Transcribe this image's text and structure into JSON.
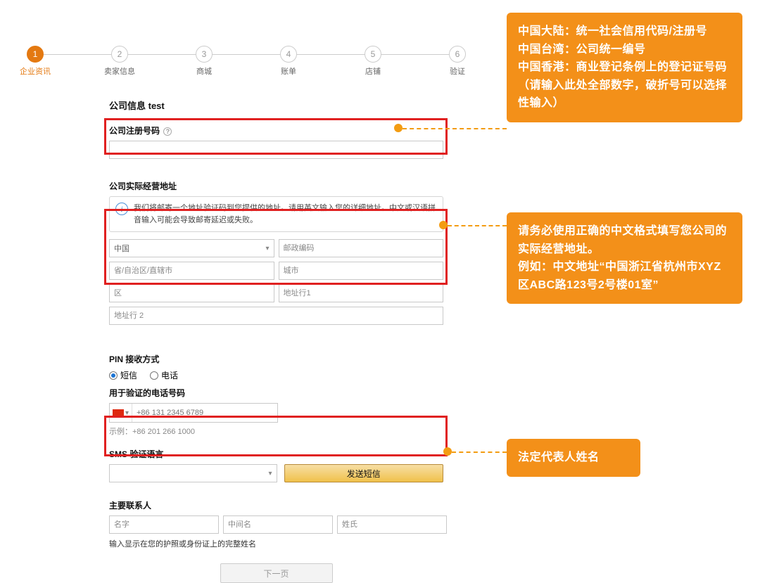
{
  "stepper": {
    "active_index": 0,
    "steps": [
      {
        "num": "1",
        "label": "企业资讯"
      },
      {
        "num": "2",
        "label": "卖家信息"
      },
      {
        "num": "3",
        "label": "商城"
      },
      {
        "num": "4",
        "label": "账单"
      },
      {
        "num": "5",
        "label": "店铺"
      },
      {
        "num": "6",
        "label": "验证"
      }
    ]
  },
  "company": {
    "title": "公司信息 test",
    "regnum_label": "公司注册号码",
    "regnum_value": ""
  },
  "address": {
    "title": "公司实际经营地址",
    "info_text": "我们将邮寄一个地址验证码到您提供的地址。请用英文输入您的详细地址。中文或汉语拼音输入可能会导致邮寄延迟或失败。",
    "fields": {
      "country": "中国",
      "zip_placeholder": "邮政编码",
      "province_placeholder": "省/自治区/直辖市",
      "city_placeholder": "城市",
      "district_placeholder": "区",
      "addr1_placeholder": "地址行1",
      "addr2_placeholder": "地址行 2"
    }
  },
  "pin": {
    "title": "PIN 接收方式",
    "radio_sms": "短信",
    "radio_call": "电话",
    "phone_label": "用于验证的电话号码",
    "phone_placeholder": "+86 131 2345 6789",
    "example": "示例：+86 201 266 1000",
    "sms_lang_label": "SMS 验证语言",
    "send_btn": "发送短信"
  },
  "contact": {
    "title": "主要联系人",
    "first_placeholder": "名字",
    "middle_placeholder": "中间名",
    "last_placeholder": "姓氏",
    "hint": "输入显示在您的护照或身份证上的完整姓名"
  },
  "next_label": "下一页",
  "callouts": {
    "c1": "中国大陆：统一社会信用代码/注册号\n中国台湾：公司统一编号\n中国香港：商业登记条例上的登记证号码（请输入此处全部数字，破折号可以选择性输入）",
    "c2": "请务必使用正确的中文格式填写您公司的实际经营地址。\n例如：中文地址“中国浙江省杭州市XYZ区ABC路123号2号楼01室”",
    "c3": "法定代表人姓名"
  }
}
